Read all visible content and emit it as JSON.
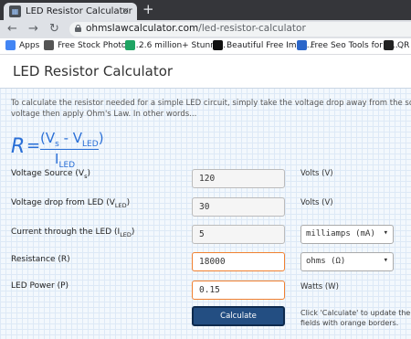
{
  "browser": {
    "tab_title": "LED Resistor Calculator",
    "tab_close": "×",
    "new_tab": "+",
    "url_host": "ohmslawcalculator.com",
    "url_path": "/led-resistor-calculator",
    "bookmarks": [
      {
        "label": "Apps",
        "color": "#4285f4"
      },
      {
        "label": "Free Stock Photos,...",
        "color": "#555555"
      },
      {
        "label": "2.6 million+ Stunni...",
        "color": "#1fa463"
      },
      {
        "label": "Beautiful Free Imag...",
        "color": "#111111"
      },
      {
        "label": "Free Seo Tools for k...",
        "color": "#2b66c9"
      },
      {
        "label": "QR C",
        "color": "#222222"
      }
    ]
  },
  "page": {
    "title": "LED Resistor Calculator",
    "intro_line1": "To calculate the resistor needed for a simple LED circuit, simply take the voltage drop away from the sou",
    "intro_line2": "voltage then apply Ohm's Law. In other words..."
  },
  "formula": {
    "lhs": "R",
    "eq": "=",
    "open": "(V",
    "vs_sub": "s",
    "minus": " - V",
    "vled_sub": "LED",
    "close": ")",
    "den": "I",
    "den_sub": "LED"
  },
  "rows": {
    "source": {
      "label": "Voltage Source (V",
      "sub": "s",
      "end": ")",
      "value": "120",
      "unit": "Volts (V)"
    },
    "drop": {
      "label": "Voltage drop from LED (V",
      "sub": "LED",
      "end": ")",
      "value": "30",
      "unit": "Volts (V)"
    },
    "current": {
      "label": "Current through the LED (I",
      "sub": "LED",
      "end": ")",
      "value": "5",
      "unit_select": "milliamps (mA)"
    },
    "resistance": {
      "label": "Resistance (R)",
      "value": "18000",
      "unit_select": "ohms (Ω)"
    },
    "power": {
      "label": "LED Power (P)",
      "value": "0.15",
      "unit": "Watts (W)"
    }
  },
  "calculate": {
    "label": "Calculate",
    "note_line1": "Click 'Calculate' to update the",
    "note_line2": "fields with orange borders."
  },
  "colors": {
    "accent": "#f08030",
    "button": "#234e82",
    "formula": "#2a6fd6"
  }
}
